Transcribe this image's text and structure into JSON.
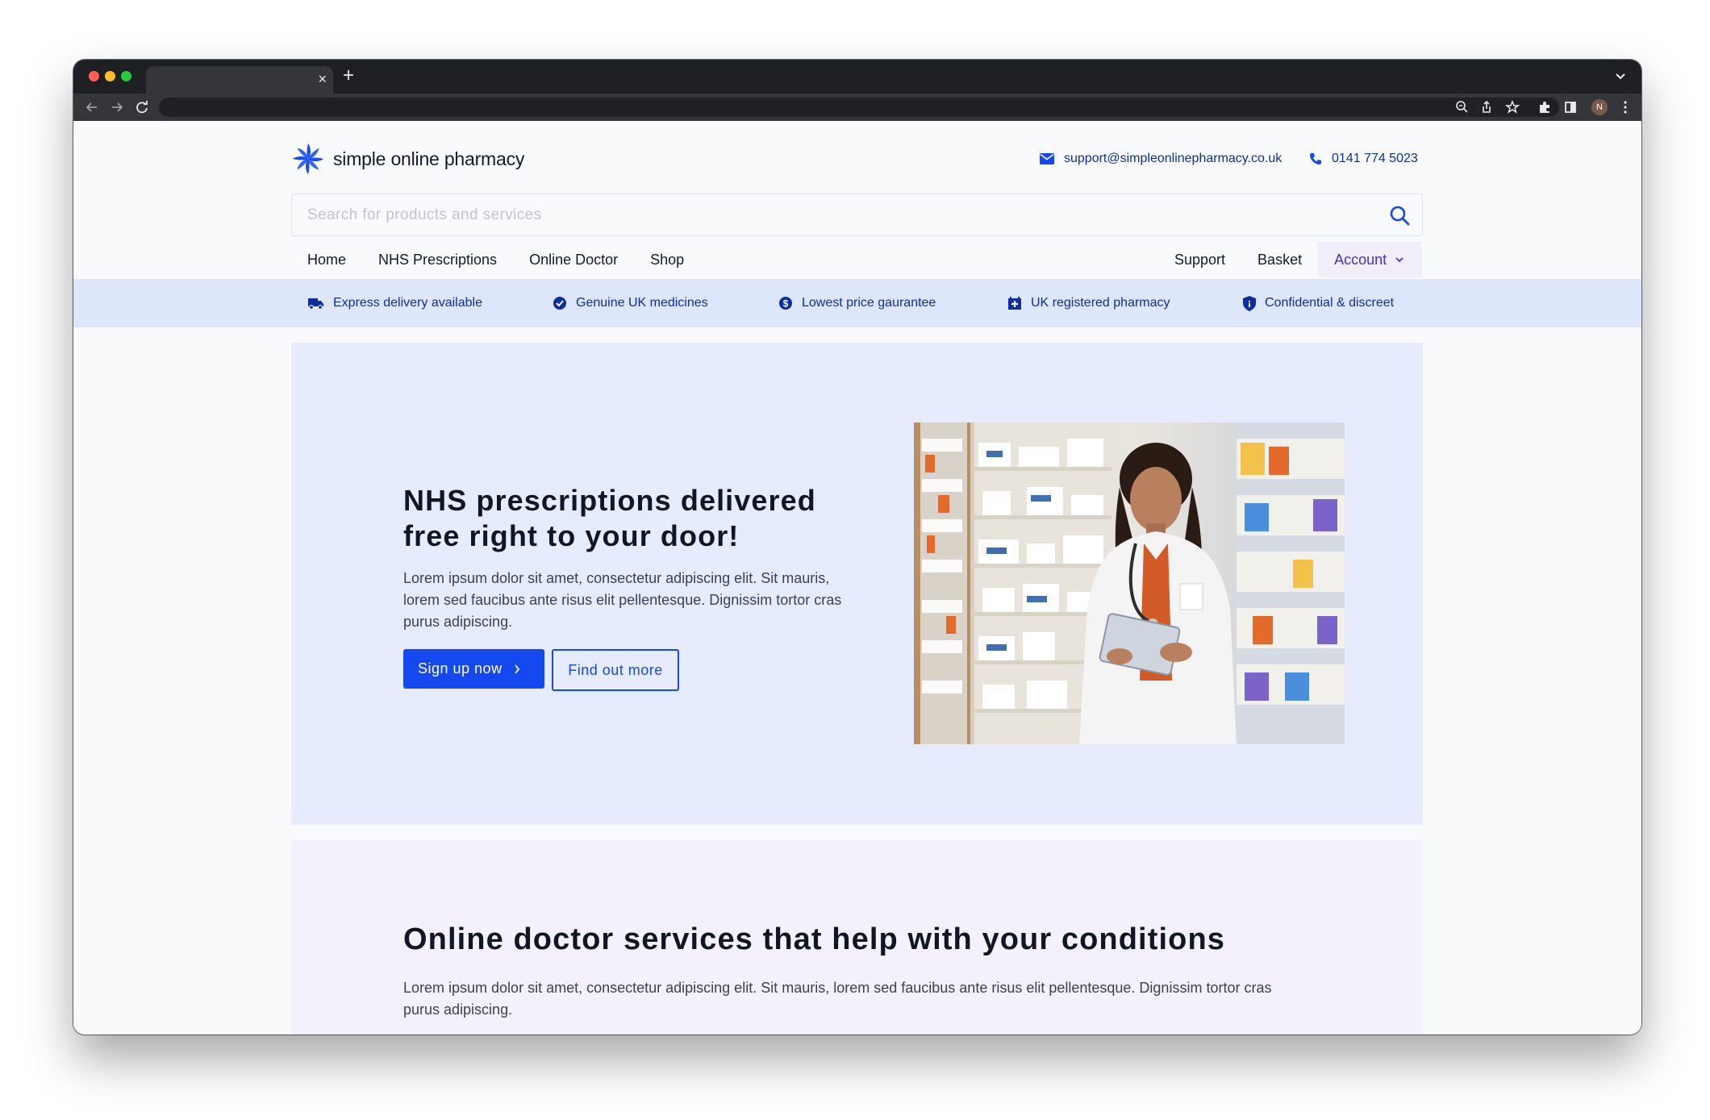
{
  "browser": {
    "tab_close": "×",
    "new_tab": "+",
    "profile_initial": "N"
  },
  "header": {
    "logo_text": "simple online pharmacy",
    "email": "support@simpleonlinepharmacy.co.uk",
    "phone": "0141 774 5023"
  },
  "search": {
    "placeholder": "Search for products and services"
  },
  "nav": {
    "left": [
      "Home",
      "NHS Prescriptions",
      "Online Doctor",
      "Shop"
    ],
    "right": [
      "Support",
      "Basket"
    ],
    "account_label": "Account"
  },
  "usp": [
    {
      "label": "Express delivery available",
      "icon": "truck-icon"
    },
    {
      "label": "Genuine UK medicines",
      "icon": "check-badge-icon"
    },
    {
      "label": "Lowest price gaurantee",
      "icon": "dollar-coin-icon"
    },
    {
      "label": "UK registered pharmacy",
      "icon": "pharmacy-cross-icon"
    },
    {
      "label": "Confidential & discreet",
      "icon": "shield-icon"
    }
  ],
  "hero": {
    "title": "NHS prescriptions delivered free right to your door!",
    "text": "Lorem ipsum dolor sit amet, consectetur adipiscing elit. Sit mauris, lorem sed faucibus ante risus elit pellentesque. Dignissim tortor cras purus adipiscing.",
    "primary_button": "Sign up now",
    "secondary_button": "Find out more"
  },
  "doctor_section": {
    "title": "Online doctor services that help with your conditions",
    "text": "Lorem ipsum dolor sit amet, consectetur adipiscing elit. Sit mauris, lorem sed faucibus ante risus elit pellentesque. Dignissim tortor cras purus adipiscing."
  },
  "colors": {
    "brand_blue": "#1449f0",
    "navy_text": "#0d2ea0",
    "usp_bar": "#dde6fb",
    "hero_bg": "#e6ecfd",
    "doctor_bg": "#f4f1fc",
    "account_highlight": "#f1eef9"
  }
}
